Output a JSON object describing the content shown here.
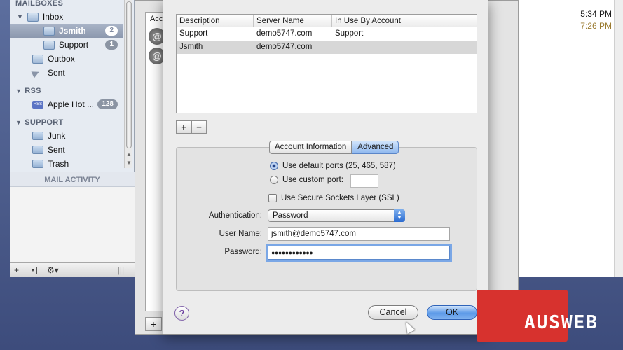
{
  "sidebar": {
    "sections": [
      "MAILBOXES",
      "RSS",
      "SUPPORT"
    ],
    "items": [
      {
        "label": "Inbox",
        "badge": ""
      },
      {
        "label": "Jsmith",
        "badge": "2"
      },
      {
        "label": "Support",
        "badge": "1"
      },
      {
        "label": "Outbox",
        "badge": ""
      },
      {
        "label": "Sent",
        "badge": ""
      },
      {
        "label": "Apple Hot ...",
        "badge": "128"
      },
      {
        "label": "Junk",
        "badge": ""
      },
      {
        "label": "Sent",
        "badge": ""
      },
      {
        "label": "Trash",
        "badge": ""
      }
    ],
    "activity_label": "MAIL ACTIVITY",
    "toolbar": {
      "add": "+",
      "gear": "⚙▾",
      "resize": "|||"
    }
  },
  "background_window": {
    "accounts_header": "Acc",
    "add": "+"
  },
  "mail_list": {
    "times": [
      "5:34 PM",
      "7:26 PM"
    ]
  },
  "sheet": {
    "table": {
      "columns": [
        "Description",
        "Server Name",
        "In Use By Account"
      ],
      "rows": [
        {
          "description": "Support",
          "server": "demo5747.com",
          "account": "Support"
        },
        {
          "description": "Jsmith",
          "server": "demo5747.com",
          "account": ""
        }
      ]
    },
    "add_button": "+",
    "remove_button": "−",
    "tabs": [
      "Account Information",
      "Advanced"
    ],
    "active_tab": "Advanced",
    "ports": {
      "default_label": "Use default ports (25, 465, 587)",
      "custom_label": "Use custom port:",
      "custom_value": "",
      "selected": "default"
    },
    "ssl_label": "Use Secure Sockets Layer (SSL)",
    "ssl_checked": false,
    "authentication": {
      "label": "Authentication:",
      "value": "Password"
    },
    "user_name": {
      "label": "User Name:",
      "value": "jsmith@demo5747.com"
    },
    "password": {
      "label": "Password:",
      "value": "●●●●●●●●●●●●"
    },
    "help": "?",
    "cancel_label": "Cancel",
    "ok_label": "OK"
  },
  "watermark": {
    "text": "AUSWEB",
    "color": "#d7322e"
  }
}
